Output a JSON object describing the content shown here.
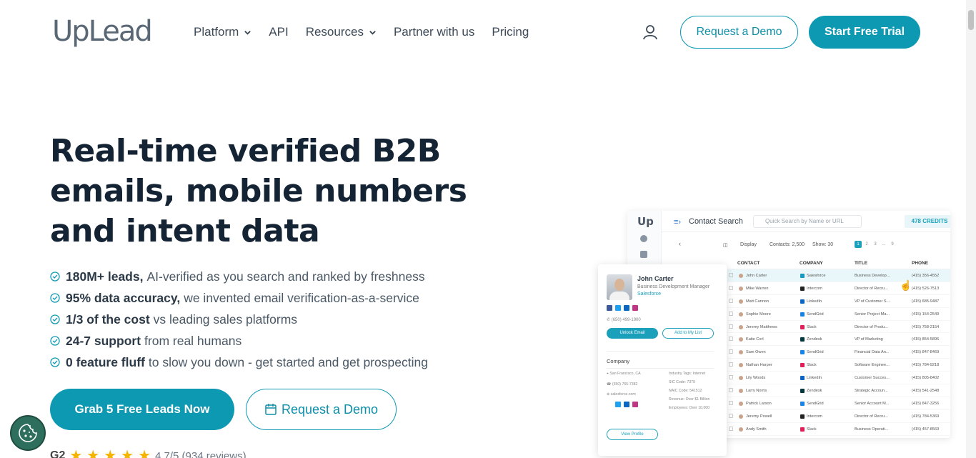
{
  "header": {
    "logo": "UpLead",
    "nav": [
      {
        "label": "Platform",
        "dropdown": true
      },
      {
        "label": "API",
        "dropdown": false
      },
      {
        "label": "Resources",
        "dropdown": true
      },
      {
        "label": "Partner with us",
        "dropdown": false
      },
      {
        "label": "Pricing",
        "dropdown": false
      }
    ],
    "request_demo": "Request a Demo",
    "start_trial": "Start Free Trial"
  },
  "hero": {
    "headline": "Real-time verified B2B emails, mobile numbers and intent data",
    "features": [
      {
        "bold": "180M+ leads,",
        "rest": "AI-verified as you search and ranked by freshness"
      },
      {
        "bold": "95% data accuracy,",
        "rest": "we invented email verification-as-a-service"
      },
      {
        "bold": "1/3 of the cost",
        "rest": "vs leading sales platforms"
      },
      {
        "bold": "24-7 support",
        "rest": "from real humans"
      },
      {
        "bold": "0 feature fluff",
        "rest": "to slow you down - get started and get prospecting"
      }
    ],
    "cta_primary": "Grab 5 Free Leads Now",
    "cta_secondary": "Request a Demo",
    "rating": {
      "brand": "G2",
      "stars": 5,
      "text": "4.7/5 (934 reviews)"
    }
  },
  "app": {
    "logo": "Up",
    "title": "Contact Search",
    "search_placeholder": "Quick Search by Name or URL",
    "credits": "478 CREDITS",
    "toolbar": {
      "display": "Display",
      "contacts": "Contacts: 2,500",
      "show": "Show: 30",
      "pages": [
        "1",
        "2",
        "3",
        "...",
        "9"
      ]
    },
    "columns": [
      "CONTACT",
      "COMPANY",
      "TITLE",
      "PHONE"
    ],
    "rows": [
      {
        "contact": "John Carter",
        "company": "Salesforce",
        "title": "Business Develop...",
        "phone": "(415) 356-4552",
        "color": "#1798c1"
      },
      {
        "contact": "Mike Warren",
        "company": "Intercom",
        "title": "Director of Recru...",
        "phone": "(415) 526-7513",
        "color": "#222222"
      },
      {
        "contact": "Matt Cannon",
        "company": "LinkedIn",
        "title": "VP of Customer S...",
        "phone": "(415) 685-9487",
        "color": "#0a66c2"
      },
      {
        "contact": "Sophie Moore",
        "company": "SendGrid",
        "title": "Senior Project Ma...",
        "phone": "(415) 154-2549",
        "color": "#1a82e2"
      },
      {
        "contact": "Jeremy Matthews",
        "company": "Slack",
        "title": "Director of Produ...",
        "phone": "(415) 758-2154",
        "color": "#e01e5a"
      },
      {
        "contact": "Katie Corl",
        "company": "Zendesk",
        "title": "VP of Marketing",
        "phone": "(415) 854-5896",
        "color": "#03363d"
      },
      {
        "contact": "Sam Owen",
        "company": "SendGrid",
        "title": "Financial Data An...",
        "phone": "(415) 847-8469",
        "color": "#1a82e2"
      },
      {
        "contact": "Nathan Harper",
        "company": "Slack",
        "title": "Software Enginee...",
        "phone": "(415) 784-9218",
        "color": "#e01e5a"
      },
      {
        "contact": "Lily Woods",
        "company": "LinkedIn",
        "title": "Customer Succes...",
        "phone": "(415) 805-8402",
        "color": "#0a66c2"
      },
      {
        "contact": "Larry Norris",
        "company": "Zendesk",
        "title": "Strategic Accoun...",
        "phone": "(415) 541-2548",
        "color": "#03363d"
      },
      {
        "contact": "Patrick Larson",
        "company": "SendGrid",
        "title": "Senior Account M...",
        "phone": "(415) 847-3256",
        "color": "#1a82e2"
      },
      {
        "contact": "Jeremy Powell",
        "company": "Intercom",
        "title": "Director of Recru...",
        "phone": "(415) 784-5369",
        "color": "#222222"
      },
      {
        "contact": "Andy Smith",
        "company": "Slack",
        "title": "Business Operati...",
        "phone": "(415) 457-8569",
        "color": "#e01e5a"
      }
    ]
  },
  "card": {
    "name": "John Carter",
    "title": "Business Development Manager",
    "company": "Salesforce",
    "phone": "(650) 499-1900",
    "unlock": "Unlock Email",
    "add": "Add to My List",
    "section": "Company",
    "location": "San Francisco, CA",
    "company_phone": "(650) 765-7382",
    "website": "salesforce.com",
    "industry": "Industry Tags: Internet",
    "sic": "SIC Code: 7379",
    "naics": "NAIC Code: 541512",
    "revenue": "Revenue: Over $1 Billion",
    "employees": "Employees: Over 10,000",
    "view": "View Profile"
  },
  "colors": {
    "accent": "#0e99b3",
    "heading": "#142434",
    "body": "#4a5866"
  }
}
